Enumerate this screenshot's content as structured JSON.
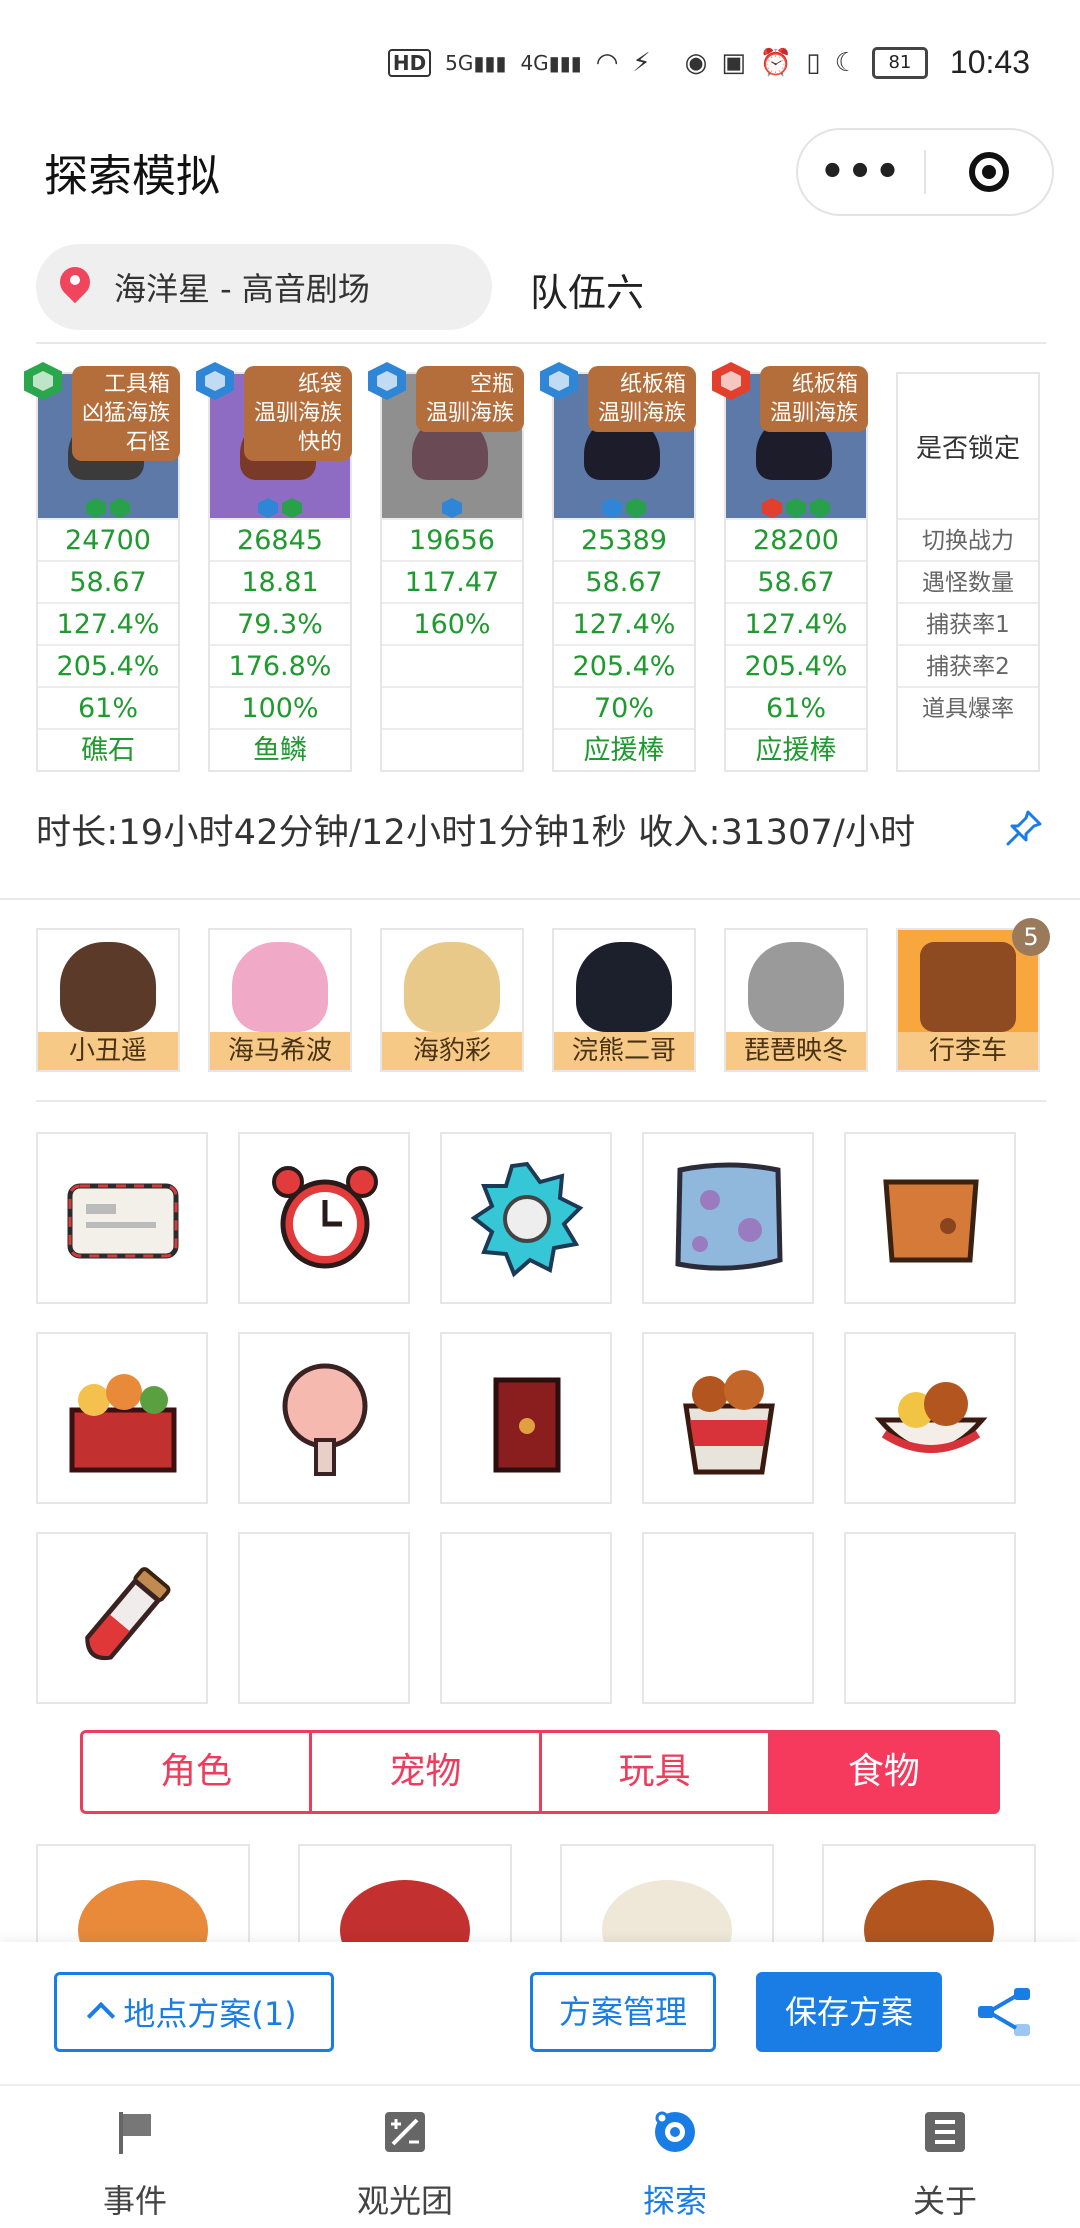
{
  "status_bar": {
    "network_hd": "HD",
    "net1": "5G",
    "net2": "4G",
    "battery": "81",
    "time": "10:43"
  },
  "header": {
    "title": "探索模拟"
  },
  "location": {
    "text": "海洋星 - 高音剧场",
    "team": "队伍六"
  },
  "members": [
    {
      "tag_lines": [
        "工具箱",
        "凶猛海族",
        "石怪"
      ],
      "stats": [
        "24700",
        "58.67",
        "127.4%",
        "205.4%",
        "61%",
        "礁石"
      ]
    },
    {
      "tag_lines": [
        "纸袋",
        "温驯海族",
        "快的"
      ],
      "stats": [
        "26845",
        "18.81",
        "79.3%",
        "176.8%",
        "100%",
        "鱼鳞"
      ]
    },
    {
      "tag_lines": [
        "空瓶",
        "温驯海族"
      ],
      "stats": [
        "19656",
        "117.47",
        "160%",
        "",
        "",
        ""
      ]
    },
    {
      "tag_lines": [
        "纸板箱",
        "温驯海族"
      ],
      "stats": [
        "25389",
        "58.67",
        "127.4%",
        "205.4%",
        "70%",
        "应援棒"
      ]
    },
    {
      "tag_lines": [
        "纸板箱",
        "温驯海族"
      ],
      "stats": [
        "28200",
        "58.67",
        "127.4%",
        "205.4%",
        "61%",
        "应援棒"
      ]
    }
  ],
  "lock_column": {
    "title": "是否锁定",
    "rows": [
      "切换战力",
      "遇怪数量",
      "捕获率1",
      "捕获率2",
      "道具爆率"
    ]
  },
  "duration_text": "时长:19小时42分钟/12小时1分钟1秒 收入:31307/小时",
  "characters": [
    {
      "name": "小丑遥"
    },
    {
      "name": "海马希波"
    },
    {
      "name": "海豹彩"
    },
    {
      "name": "浣熊二哥"
    },
    {
      "name": "琵琶映冬"
    },
    {
      "name": "行李车"
    }
  ],
  "character_badge": "5",
  "items": [
    {
      "icon": "envelope-icon"
    },
    {
      "icon": "alarm-clock-icon"
    },
    {
      "icon": "gear-gem-icon"
    },
    {
      "icon": "blue-blanket-icon"
    },
    {
      "icon": "paper-bag-icon"
    },
    {
      "icon": "food-box-icon"
    },
    {
      "icon": "hand-fan-icon"
    },
    {
      "icon": "red-box-icon"
    },
    {
      "icon": "fried-chicken-bucket-icon"
    },
    {
      "icon": "chicken-bowl-icon"
    },
    {
      "icon": "potion-vial-icon"
    },
    {
      "icon": ""
    },
    {
      "icon": ""
    },
    {
      "icon": ""
    },
    {
      "icon": ""
    }
  ],
  "tabs": [
    {
      "label": "角色"
    },
    {
      "label": "宠物"
    },
    {
      "label": "玩具"
    },
    {
      "label": "食物",
      "active": true
    }
  ],
  "actions": {
    "plan_label": "地点方案(1)",
    "manage_label": "方案管理",
    "save_label": "保存方案"
  },
  "nav": [
    {
      "label": "事件",
      "icon": "flag-icon"
    },
    {
      "label": "观光团",
      "icon": "calculator-icon"
    },
    {
      "label": "探索",
      "icon": "explore-icon",
      "active": true
    },
    {
      "label": "关于",
      "icon": "list-icon"
    }
  ],
  "colors": {
    "accent_blue": "#1a7de6",
    "tab_red": "#f53a5e",
    "stat_green": "#1f9a2e",
    "tag_brown": "#b46e3c"
  }
}
